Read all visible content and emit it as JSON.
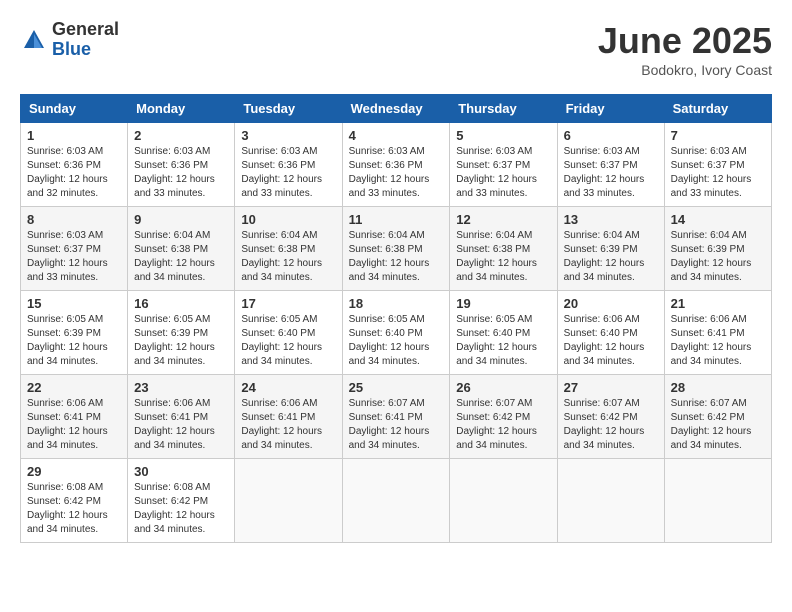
{
  "header": {
    "logo_general": "General",
    "logo_blue": "Blue",
    "month_title": "June 2025",
    "location": "Bodokro, Ivory Coast"
  },
  "weekdays": [
    "Sunday",
    "Monday",
    "Tuesday",
    "Wednesday",
    "Thursday",
    "Friday",
    "Saturday"
  ],
  "weeks": [
    [
      {
        "day": "1",
        "sunrise": "6:03 AM",
        "sunset": "6:36 PM",
        "daylight": "12 hours and 32 minutes."
      },
      {
        "day": "2",
        "sunrise": "6:03 AM",
        "sunset": "6:36 PM",
        "daylight": "12 hours and 33 minutes."
      },
      {
        "day": "3",
        "sunrise": "6:03 AM",
        "sunset": "6:36 PM",
        "daylight": "12 hours and 33 minutes."
      },
      {
        "day": "4",
        "sunrise": "6:03 AM",
        "sunset": "6:36 PM",
        "daylight": "12 hours and 33 minutes."
      },
      {
        "day": "5",
        "sunrise": "6:03 AM",
        "sunset": "6:37 PM",
        "daylight": "12 hours and 33 minutes."
      },
      {
        "day": "6",
        "sunrise": "6:03 AM",
        "sunset": "6:37 PM",
        "daylight": "12 hours and 33 minutes."
      },
      {
        "day": "7",
        "sunrise": "6:03 AM",
        "sunset": "6:37 PM",
        "daylight": "12 hours and 33 minutes."
      }
    ],
    [
      {
        "day": "8",
        "sunrise": "6:03 AM",
        "sunset": "6:37 PM",
        "daylight": "12 hours and 33 minutes."
      },
      {
        "day": "9",
        "sunrise": "6:04 AM",
        "sunset": "6:38 PM",
        "daylight": "12 hours and 34 minutes."
      },
      {
        "day": "10",
        "sunrise": "6:04 AM",
        "sunset": "6:38 PM",
        "daylight": "12 hours and 34 minutes."
      },
      {
        "day": "11",
        "sunrise": "6:04 AM",
        "sunset": "6:38 PM",
        "daylight": "12 hours and 34 minutes."
      },
      {
        "day": "12",
        "sunrise": "6:04 AM",
        "sunset": "6:38 PM",
        "daylight": "12 hours and 34 minutes."
      },
      {
        "day": "13",
        "sunrise": "6:04 AM",
        "sunset": "6:39 PM",
        "daylight": "12 hours and 34 minutes."
      },
      {
        "day": "14",
        "sunrise": "6:04 AM",
        "sunset": "6:39 PM",
        "daylight": "12 hours and 34 minutes."
      }
    ],
    [
      {
        "day": "15",
        "sunrise": "6:05 AM",
        "sunset": "6:39 PM",
        "daylight": "12 hours and 34 minutes."
      },
      {
        "day": "16",
        "sunrise": "6:05 AM",
        "sunset": "6:39 PM",
        "daylight": "12 hours and 34 minutes."
      },
      {
        "day": "17",
        "sunrise": "6:05 AM",
        "sunset": "6:40 PM",
        "daylight": "12 hours and 34 minutes."
      },
      {
        "day": "18",
        "sunrise": "6:05 AM",
        "sunset": "6:40 PM",
        "daylight": "12 hours and 34 minutes."
      },
      {
        "day": "19",
        "sunrise": "6:05 AM",
        "sunset": "6:40 PM",
        "daylight": "12 hours and 34 minutes."
      },
      {
        "day": "20",
        "sunrise": "6:06 AM",
        "sunset": "6:40 PM",
        "daylight": "12 hours and 34 minutes."
      },
      {
        "day": "21",
        "sunrise": "6:06 AM",
        "sunset": "6:41 PM",
        "daylight": "12 hours and 34 minutes."
      }
    ],
    [
      {
        "day": "22",
        "sunrise": "6:06 AM",
        "sunset": "6:41 PM",
        "daylight": "12 hours and 34 minutes."
      },
      {
        "day": "23",
        "sunrise": "6:06 AM",
        "sunset": "6:41 PM",
        "daylight": "12 hours and 34 minutes."
      },
      {
        "day": "24",
        "sunrise": "6:06 AM",
        "sunset": "6:41 PM",
        "daylight": "12 hours and 34 minutes."
      },
      {
        "day": "25",
        "sunrise": "6:07 AM",
        "sunset": "6:41 PM",
        "daylight": "12 hours and 34 minutes."
      },
      {
        "day": "26",
        "sunrise": "6:07 AM",
        "sunset": "6:42 PM",
        "daylight": "12 hours and 34 minutes."
      },
      {
        "day": "27",
        "sunrise": "6:07 AM",
        "sunset": "6:42 PM",
        "daylight": "12 hours and 34 minutes."
      },
      {
        "day": "28",
        "sunrise": "6:07 AM",
        "sunset": "6:42 PM",
        "daylight": "12 hours and 34 minutes."
      }
    ],
    [
      {
        "day": "29",
        "sunrise": "6:08 AM",
        "sunset": "6:42 PM",
        "daylight": "12 hours and 34 minutes."
      },
      {
        "day": "30",
        "sunrise": "6:08 AM",
        "sunset": "6:42 PM",
        "daylight": "12 hours and 34 minutes."
      },
      null,
      null,
      null,
      null,
      null
    ]
  ]
}
